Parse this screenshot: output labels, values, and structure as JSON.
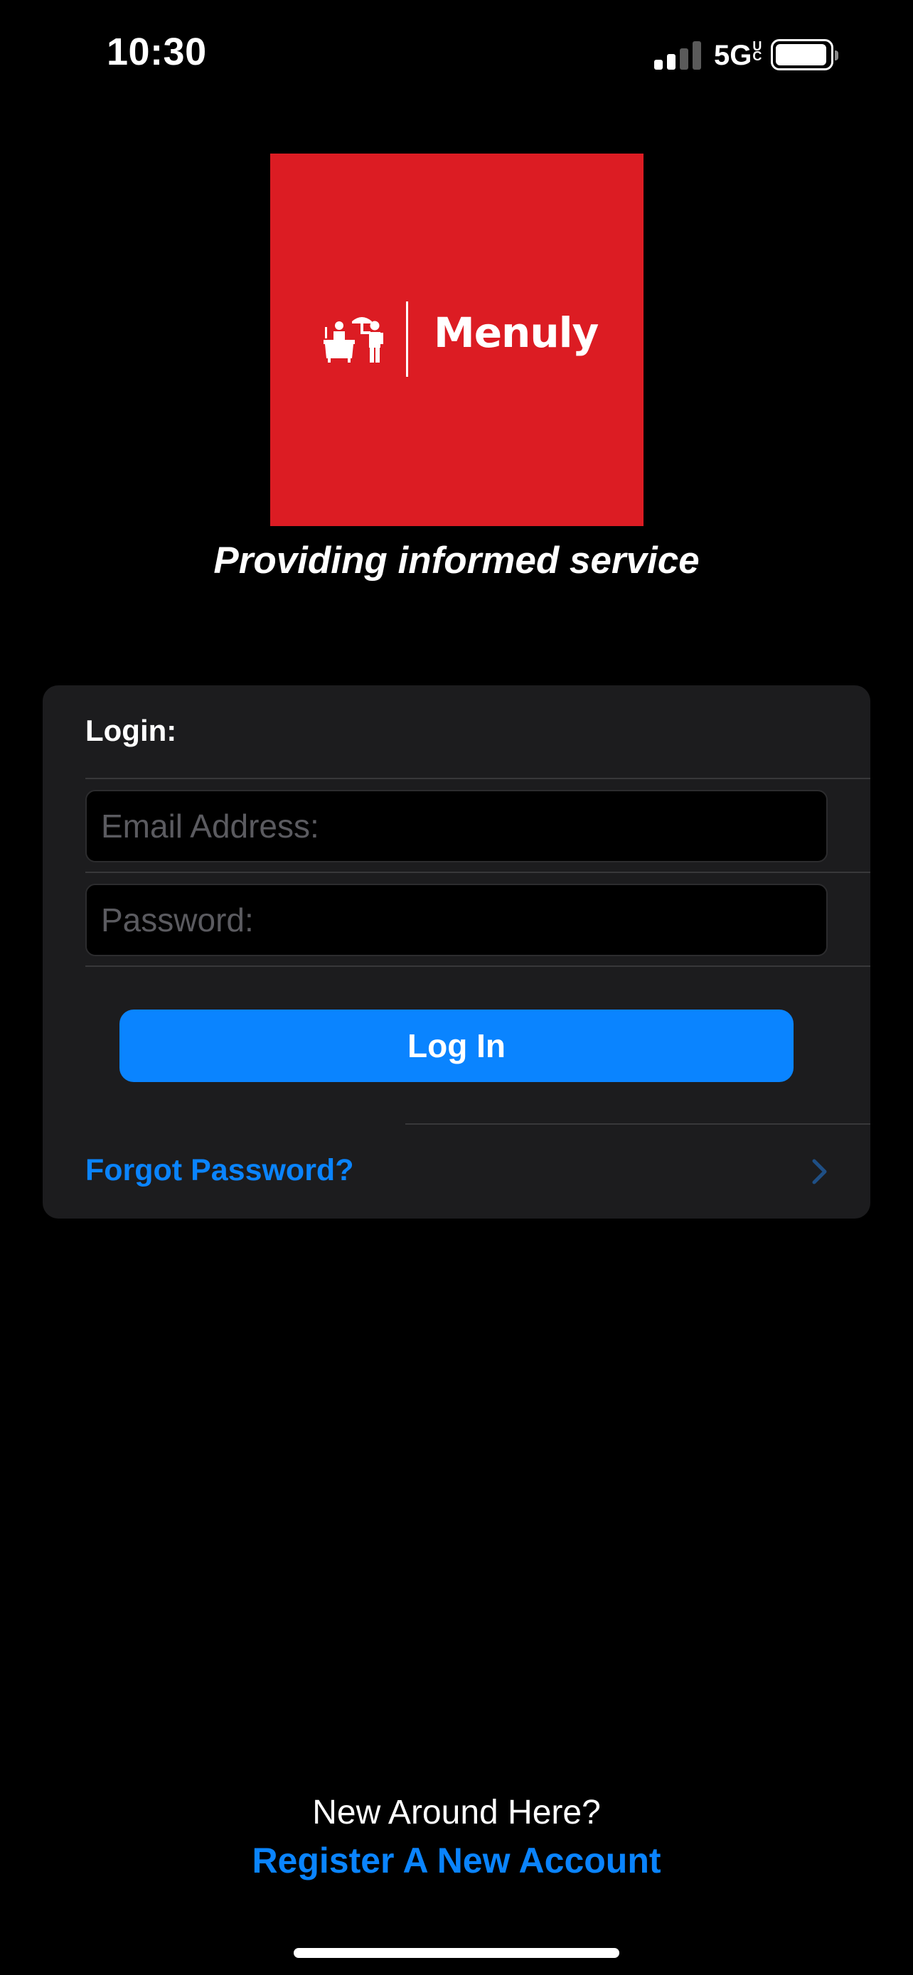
{
  "status_bar": {
    "time": "10:30",
    "network": "5G",
    "network_suffix": "UC",
    "signal_bars_active": 2,
    "signal_bars_total": 4,
    "battery_level": 0.95,
    "icons": [
      "signal-icon",
      "battery-icon"
    ]
  },
  "logo": {
    "brand_color": "#dc1c23",
    "name": "Menuly",
    "icon": "waiter-serving-icon"
  },
  "tagline": "Providing informed service",
  "login_card": {
    "title": "Login:",
    "email_placeholder": "Email Address:",
    "email_value": "",
    "password_placeholder": "Password:",
    "password_value": "",
    "login_button": "Log In",
    "forgot_password": "Forgot Password?",
    "forgot_icon": "chevron-right-icon"
  },
  "footer": {
    "prompt": "New Around Here?",
    "register_link": "Register A New Account"
  },
  "colors": {
    "background": "#000000",
    "card": "#1c1c1e",
    "accent": "#0a84ff",
    "brand": "#dc1c23"
  }
}
